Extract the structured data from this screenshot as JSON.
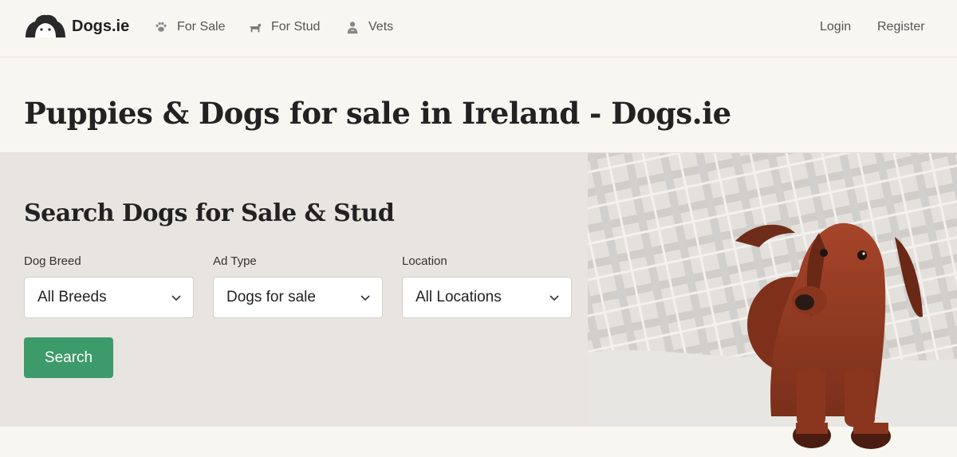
{
  "header": {
    "logo_text": "Dogs.ie",
    "nav": [
      {
        "label": "For Sale",
        "icon": "paw-icon"
      },
      {
        "label": "For Stud",
        "icon": "dog-icon"
      },
      {
        "label": "Vets",
        "icon": "vet-person-icon"
      }
    ],
    "login_label": "Login",
    "register_label": "Register"
  },
  "page_title": "Puppies & Dogs for sale in Ireland - Dogs.ie",
  "search": {
    "heading": "Search Dogs for Sale & Stud",
    "fields": [
      {
        "label": "Dog Breed",
        "value": "All Breeds"
      },
      {
        "label": "Ad Type",
        "value": "Dogs for sale"
      },
      {
        "label": "Location",
        "value": "All Locations"
      }
    ],
    "button_label": "Search"
  },
  "colors": {
    "accent_green": "#3d9a6a",
    "page_bg": "#f8f6f1",
    "panel_bg": "#e8e5e0"
  }
}
